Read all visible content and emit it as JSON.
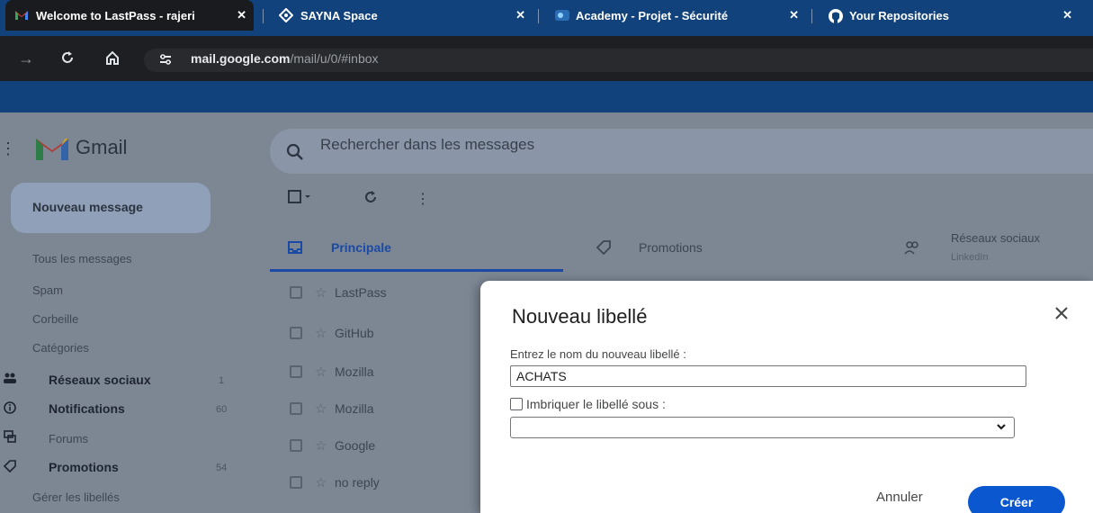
{
  "browser": {
    "tabs": [
      {
        "title": "Welcome to LastPass - rajeri",
        "favicon": "gmail-icon",
        "active": true
      },
      {
        "title": "SAYNA Space",
        "favicon": "sayna-icon",
        "active": false
      },
      {
        "title": "Academy - Projet - Sécurité",
        "favicon": "academy-icon",
        "active": false
      },
      {
        "title": "Your Repositories",
        "favicon": "github-icon",
        "active": false
      }
    ],
    "close_glyph": "✕",
    "url_host": "mail.google.com",
    "url_path": "/mail/u/0/#inbox"
  },
  "gmail": {
    "app_name": "Gmail",
    "search_placeholder": "Rechercher dans les messages",
    "compose_label": "Nouveau message",
    "sidebar": {
      "items": [
        {
          "label": "Tous les messages"
        },
        {
          "label": "Spam"
        },
        {
          "label": "Corbeille"
        },
        {
          "label": "Catégories"
        }
      ],
      "categories": [
        {
          "label": "Réseaux sociaux",
          "count": "1",
          "icon": "people-icon"
        },
        {
          "label": "Notifications",
          "count": "60",
          "icon": "info-icon"
        },
        {
          "label": "Forums",
          "count": "",
          "icon": "forum-icon"
        },
        {
          "label": "Promotions",
          "count": "54",
          "icon": "tag-icon"
        }
      ],
      "manage_labels": "Gérer les libellés"
    },
    "tabs": [
      {
        "label": "Principale",
        "icon": "inbox-icon",
        "active": true
      },
      {
        "label": "Promotions",
        "icon": "tag-icon",
        "active": false
      },
      {
        "label": "Réseaux sociaux",
        "icon": "people-icon",
        "active": false,
        "sub": "LinkedIn"
      }
    ],
    "messages": [
      {
        "sender": "LastPass"
      },
      {
        "sender": "GitHub"
      },
      {
        "sender": "Mozilla"
      },
      {
        "sender": "Mozilla"
      },
      {
        "sender": "Google"
      },
      {
        "sender": "no reply"
      }
    ]
  },
  "dialog": {
    "title": "Nouveau libellé",
    "prompt": "Entrez le nom du nouveau libellé :",
    "name_value": "ACHATS",
    "nest_label": "Imbriquer le libellé sous :",
    "nest_checked": false,
    "parent_value": "",
    "cancel_label": "Annuler",
    "create_label": "Créer"
  },
  "colors": {
    "accent": "#0b57d0",
    "chrome_blue": "#11427b"
  }
}
